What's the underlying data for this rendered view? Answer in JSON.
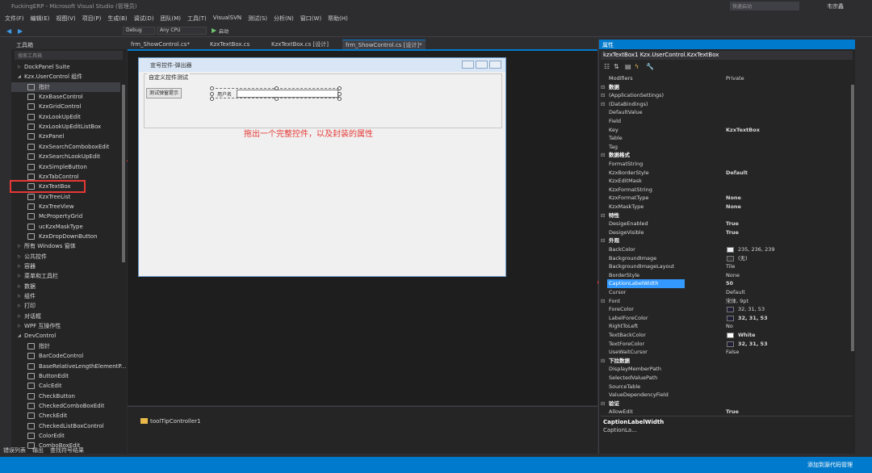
{
  "window": {
    "title": "FuckingERP - Microsoft Visual Studio (管理员)",
    "quick_launch": "快速启动",
    "user": "韦宗鑫"
  },
  "menu": [
    "文件(F)",
    "编辑(E)",
    "视图(V)",
    "项目(P)",
    "生成(B)",
    "调试(D)",
    "团队(M)",
    "工具(T)",
    "VisualSVN",
    "测试(S)",
    "分析(N)",
    "窗口(W)",
    "帮助(H)"
  ],
  "toolbar": {
    "config": "Debug",
    "platform": "Any CPU",
    "start": "启动"
  },
  "toolbox": {
    "title": "工具箱",
    "search": "搜索工具箱",
    "items": [
      {
        "label": "DockPanel Suite",
        "kind": "group"
      },
      {
        "label": "Kzx.UserControl 组件",
        "kind": "group-open"
      },
      {
        "label": "指针",
        "kind": "item",
        "sel": true
      },
      {
        "label": "KzxBaseControl",
        "kind": "item"
      },
      {
        "label": "KzxGridControl",
        "kind": "item"
      },
      {
        "label": "KzxLookUpEdit",
        "kind": "item"
      },
      {
        "label": "KzxLookUpEditListBox",
        "kind": "item"
      },
      {
        "label": "KzxPanel",
        "kind": "item"
      },
      {
        "label": "KzxSearchComboboxEdit",
        "kind": "item"
      },
      {
        "label": "KzxSearchLookUpEdit",
        "kind": "item"
      },
      {
        "label": "KzxSimpleButton",
        "kind": "item"
      },
      {
        "label": "KzxTabControl",
        "kind": "item"
      },
      {
        "label": "KzxTextBox",
        "kind": "item",
        "boxed": true
      },
      {
        "label": "KzxTreeList",
        "kind": "item"
      },
      {
        "label": "KzxTreeView",
        "kind": "item"
      },
      {
        "label": "McPropertyGrid",
        "kind": "item"
      },
      {
        "label": "ucKzxMaskType",
        "kind": "item"
      },
      {
        "label": "KzxDropDownButton",
        "kind": "item"
      },
      {
        "label": "所有 Windows 窗体",
        "kind": "group"
      },
      {
        "label": "公共控件",
        "kind": "group"
      },
      {
        "label": "容器",
        "kind": "group"
      },
      {
        "label": "菜单和工具栏",
        "kind": "group"
      },
      {
        "label": "数据",
        "kind": "group"
      },
      {
        "label": "组件",
        "kind": "group"
      },
      {
        "label": "打印",
        "kind": "group"
      },
      {
        "label": "对话框",
        "kind": "group"
      },
      {
        "label": "WPF 互操作性",
        "kind": "group"
      },
      {
        "label": "DevControl",
        "kind": "group-open"
      },
      {
        "label": "指针",
        "kind": "item"
      },
      {
        "label": "BarCodeControl",
        "kind": "item"
      },
      {
        "label": "BaseRelativeLengthElementP...",
        "kind": "item"
      },
      {
        "label": "ButtonEdit",
        "kind": "item"
      },
      {
        "label": "CalcEdit",
        "kind": "item"
      },
      {
        "label": "CheckButton",
        "kind": "item"
      },
      {
        "label": "CheckedComboBoxEdit",
        "kind": "item"
      },
      {
        "label": "CheckEdit",
        "kind": "item"
      },
      {
        "label": "CheckedListBoxControl",
        "kind": "item"
      },
      {
        "label": "ColorEdit",
        "kind": "item"
      },
      {
        "label": "ComboBoxEdit",
        "kind": "item"
      }
    ]
  },
  "doc_tabs": [
    "frm_ShowControl.cs*",
    "KzxTextBox.cs",
    "KzxTextBox.cs [设计]",
    "frm_ShowControl.cs [设计]*"
  ],
  "form": {
    "title": "宣号控件-弹出器",
    "group_label": "自定义控件测试",
    "test_button": "测试弹窗提示",
    "textbox_label": "用户名"
  },
  "annotation": "拖出一个完整控件，以及封装的属性",
  "tray": {
    "component": "toolTipController1"
  },
  "properties": {
    "title": "属性",
    "object": "kzxTextBox1  Kzx.UserControl.KzxTextBox",
    "rows": [
      {
        "n": "Modifiers",
        "v": "Private"
      },
      {
        "n": "数据",
        "cat": true
      },
      {
        "n": "(ApplicationSettings)",
        "exp": true
      },
      {
        "n": "(DataBindings)",
        "exp": true
      },
      {
        "n": "DefaultValue",
        "v": ""
      },
      {
        "n": "Field",
        "v": ""
      },
      {
        "n": "Key",
        "v": "KzxTextBox",
        "b": true
      },
      {
        "n": "Table",
        "v": ""
      },
      {
        "n": "Tag",
        "v": ""
      },
      {
        "n": "数据格式",
        "cat": true
      },
      {
        "n": "FormatString",
        "v": ""
      },
      {
        "n": "KzxBorderStyle",
        "v": "Default",
        "b": true
      },
      {
        "n": "KzxEditMask",
        "v": ""
      },
      {
        "n": "KzxFormatString",
        "v": ""
      },
      {
        "n": "KzxFormatType",
        "v": "None",
        "b": true
      },
      {
        "n": "KzxMaskType",
        "v": "None",
        "b": true
      },
      {
        "n": "特性",
        "cat": true
      },
      {
        "n": "DesigeEnabled",
        "v": "True",
        "b": true
      },
      {
        "n": "DesigeVisible",
        "v": "True",
        "b": true
      },
      {
        "n": "外观",
        "cat": true
      },
      {
        "n": "BackColor",
        "v": "235, 236, 239",
        "sw": "#ebecef"
      },
      {
        "n": "BackgroundImage",
        "v": "(无)",
        "sw": "#333333"
      },
      {
        "n": "BackgroundImageLayout",
        "v": "Tile"
      },
      {
        "n": "BorderStyle",
        "v": "None"
      },
      {
        "n": "CaptionLabelWidth",
        "v": "50",
        "b": true,
        "sel": true
      },
      {
        "n": "Cursor",
        "v": "Default"
      },
      {
        "n": "Font",
        "v": "宋体, 9pt",
        "exp": true
      },
      {
        "n": "ForeColor",
        "v": "32, 31, 53",
        "sw": "#201f35"
      },
      {
        "n": "LabelForeColor",
        "v": "32, 31, 53",
        "sw": "#201f35",
        "b": true
      },
      {
        "n": "RightToLeft",
        "v": "No"
      },
      {
        "n": "TextBackColor",
        "v": "White",
        "sw": "#ffffff",
        "b": true
      },
      {
        "n": "TextForeColor",
        "v": "32, 31, 53",
        "sw": "#201f35",
        "b": true
      },
      {
        "n": "UseWaitCursor",
        "v": "False"
      },
      {
        "n": "下拉数据",
        "cat": true
      },
      {
        "n": "DisplayMemberPath",
        "v": ""
      },
      {
        "n": "SelectedValuePath",
        "v": ""
      },
      {
        "n": "SourceTable",
        "v": ""
      },
      {
        "n": "ValueDependencyField",
        "v": ""
      },
      {
        "n": "验证",
        "cat": true
      },
      {
        "n": "AllowEdit",
        "v": "True",
        "b": true
      }
    ],
    "desc_title": "CaptionLabelWidth",
    "desc_text": "CaptionLa..."
  },
  "bottom_tabs": [
    "错误列表",
    "输出",
    "查找符号结果"
  ],
  "status": {
    "right": "添加到源代码管理"
  }
}
